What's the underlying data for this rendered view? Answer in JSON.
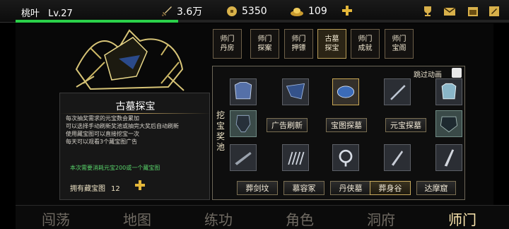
{
  "player": {
    "name": "桃叶",
    "level": "Lv.27",
    "xp_fraction": 0.33
  },
  "resources": {
    "power": "3.6万",
    "coins": "5350",
    "ingots": "109"
  },
  "top_icons": [
    "trophy-icon",
    "mail-icon",
    "calendar-icon",
    "settings-icon"
  ],
  "tabs": [
    {
      "label": "师门丹房"
    },
    {
      "label": "师门探案"
    },
    {
      "label": "师门押镖"
    },
    {
      "label": "古墓探宝",
      "active": true
    },
    {
      "label": "师门成就"
    },
    {
      "label": "师门宝阁"
    }
  ],
  "desc": {
    "title": "古墓探宝",
    "lines": [
      "每次抽奖需求的元宝数会累加",
      "可以选择手动刷新奖池或抽完大奖后自动刷新",
      "使用藏宝图可以直接挖宝一次",
      "每天可以观看3个藏宝图广告"
    ],
    "cost_note": "本次需要消耗元宝200或一个藏宝图",
    "own_label": "拥有藏宝图",
    "own_count": "12"
  },
  "pool": {
    "skip_label": "跳过动画",
    "side_label": "挖宝奖池",
    "actions": [
      "广告刷新",
      "宝图探墓",
      "元宝探墓"
    ],
    "tombs": [
      "葬剑坟",
      "慕容冢",
      "丹侠墓",
      "葬身谷",
      "达摩窟"
    ],
    "selected_tomb": 3,
    "items": [
      "armor-icon",
      "cloth-icon",
      "orb-icon",
      "sword-icon",
      "chest-armor-icon",
      "helmet-icon",
      "mask-icon",
      "rod-icon",
      "claw-icon",
      "ring-icon",
      "dagger-icon",
      "saber-icon"
    ]
  },
  "nav": [
    {
      "label": "闯荡"
    },
    {
      "label": "地图"
    },
    {
      "label": "练功"
    },
    {
      "label": "角色"
    },
    {
      "label": "洞府"
    },
    {
      "label": "师门",
      "active": true
    }
  ]
}
